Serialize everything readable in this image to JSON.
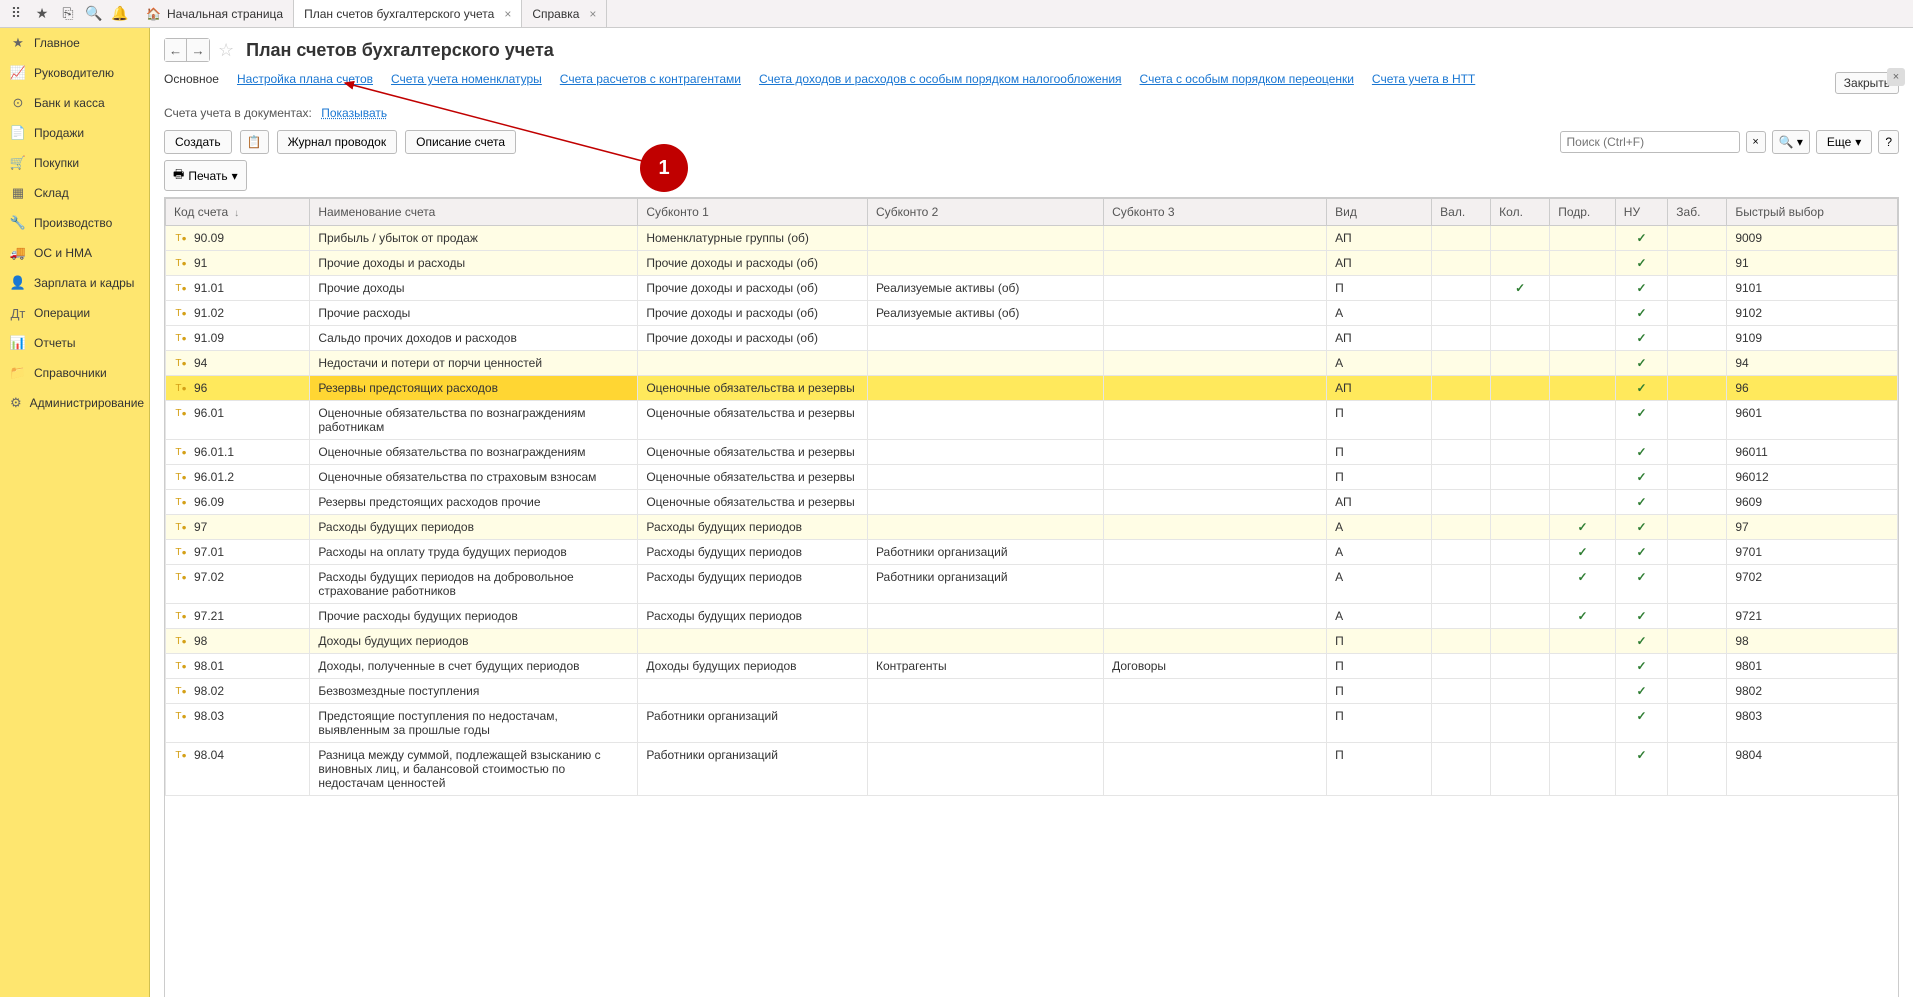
{
  "top_tabs": {
    "home": "Начальная страница",
    "tab1": "План счетов бухгалтерского учета",
    "tab2": "Справка"
  },
  "sidebar": {
    "items": [
      {
        "icon": "★",
        "label": "Главное"
      },
      {
        "icon": "📈",
        "label": "Руководителю"
      },
      {
        "icon": "⊙",
        "label": "Банк и касса"
      },
      {
        "icon": "📄",
        "label": "Продажи"
      },
      {
        "icon": "🛒",
        "label": "Покупки"
      },
      {
        "icon": "▦",
        "label": "Склад"
      },
      {
        "icon": "🔧",
        "label": "Производство"
      },
      {
        "icon": "🚚",
        "label": "ОС и НМА"
      },
      {
        "icon": "👤",
        "label": "Зарплата и кадры"
      },
      {
        "icon": "Дт",
        "label": "Операции"
      },
      {
        "icon": "📊",
        "label": "Отчеты"
      },
      {
        "icon": "📁",
        "label": "Справочники"
      },
      {
        "icon": "⚙",
        "label": "Администрирование"
      }
    ]
  },
  "page": {
    "title": "План счетов бухгалтерского учета",
    "close_btn": "Закрыть"
  },
  "subnav": [
    "Основное",
    "Настройка плана счетов",
    "Счета учета номенклатуры",
    "Счета расчетов с контрагентами",
    "Счета доходов и расходов с особым порядком налогообложения",
    "Счета с особым порядком переоценки",
    "Счета учета в НТТ"
  ],
  "filter": {
    "label": "Счета учета в документах:",
    "link": "Показывать"
  },
  "toolbar": {
    "create": "Создать",
    "journal": "Журнал проводок",
    "description": "Описание счета",
    "print": "Печать",
    "search_placeholder": "Поиск (Ctrl+F)",
    "more": "Еще"
  },
  "columns": {
    "code": "Код счета",
    "name": "Наименование счета",
    "sub1": "Субконто 1",
    "sub2": "Субконто 2",
    "sub3": "Субконто 3",
    "vid": "Вид",
    "val": "Вал.",
    "kol": "Кол.",
    "podr": "Подр.",
    "nu": "НУ",
    "zab": "Заб.",
    "quick": "Быстрый выбор"
  },
  "rows": [
    {
      "yellow": true,
      "icon": "y",
      "code": "90.09",
      "name": "Прибыль / убыток от продаж",
      "sub1": "Номенклатурные группы (об)",
      "sub2": "",
      "sub3": "",
      "vid": "АП",
      "val": "",
      "kol": "",
      "podr": "",
      "nu": "✓",
      "zab": "",
      "quick": "9009"
    },
    {
      "yellow": true,
      "icon": "y",
      "code": "91",
      "name": "Прочие доходы и расходы",
      "sub1": "Прочие доходы и расходы (об)",
      "sub2": "",
      "sub3": "",
      "vid": "АП",
      "val": "",
      "kol": "",
      "podr": "",
      "nu": "✓",
      "zab": "",
      "quick": "91"
    },
    {
      "yellow": false,
      "icon": "y",
      "code": "91.01",
      "name": "Прочие доходы",
      "sub1": "Прочие доходы и расходы (об)",
      "sub2": "Реализуемые активы (об)",
      "sub3": "",
      "vid": "П",
      "val": "",
      "kol": "✓",
      "podr": "",
      "nu": "✓",
      "zab": "",
      "quick": "9101"
    },
    {
      "yellow": false,
      "icon": "y",
      "code": "91.02",
      "name": "Прочие расходы",
      "sub1": "Прочие доходы и расходы (об)",
      "sub2": "Реализуемые активы (об)",
      "sub3": "",
      "vid": "А",
      "val": "",
      "kol": "",
      "podr": "",
      "nu": "✓",
      "zab": "",
      "quick": "9102"
    },
    {
      "yellow": false,
      "icon": "y",
      "code": "91.09",
      "name": "Сальдо прочих доходов и расходов",
      "sub1": "Прочие доходы и расходы (об)",
      "sub2": "",
      "sub3": "",
      "vid": "АП",
      "val": "",
      "kol": "",
      "podr": "",
      "nu": "✓",
      "zab": "",
      "quick": "9109"
    },
    {
      "yellow": true,
      "icon": "y",
      "code": "94",
      "name": "Недостачи и потери от порчи ценностей",
      "sub1": "",
      "sub2": "",
      "sub3": "",
      "vid": "А",
      "val": "",
      "kol": "",
      "podr": "",
      "nu": "✓",
      "zab": "",
      "quick": "94"
    },
    {
      "yellow": true,
      "selected": true,
      "icon": "y",
      "code": "96",
      "name": "Резервы предстоящих расходов",
      "sub1": "Оценочные обязательства и резервы",
      "sub2": "",
      "sub3": "",
      "vid": "АП",
      "val": "",
      "kol": "",
      "podr": "",
      "nu": "✓",
      "zab": "",
      "quick": "96"
    },
    {
      "yellow": false,
      "icon": "y",
      "code": "96.01",
      "name": "Оценочные обязательства по вознаграждениям работникам",
      "sub1": "Оценочные обязательства и резервы",
      "sub2": "",
      "sub3": "",
      "vid": "П",
      "val": "",
      "kol": "",
      "podr": "",
      "nu": "✓",
      "zab": "",
      "quick": "9601"
    },
    {
      "yellow": false,
      "icon": "y",
      "code": "96.01.1",
      "name": "Оценочные обязательства по вознаграждениям",
      "sub1": "Оценочные обязательства и резервы",
      "sub2": "",
      "sub3": "",
      "vid": "П",
      "val": "",
      "kol": "",
      "podr": "",
      "nu": "✓",
      "zab": "",
      "quick": "96011"
    },
    {
      "yellow": false,
      "icon": "y",
      "code": "96.01.2",
      "name": "Оценочные обязательства по страховым взносам",
      "sub1": "Оценочные обязательства и резервы",
      "sub2": "",
      "sub3": "",
      "vid": "П",
      "val": "",
      "kol": "",
      "podr": "",
      "nu": "✓",
      "zab": "",
      "quick": "96012"
    },
    {
      "yellow": false,
      "icon": "y",
      "code": "96.09",
      "name": "Резервы предстоящих расходов прочие",
      "sub1": "Оценочные обязательства и резервы",
      "sub2": "",
      "sub3": "",
      "vid": "АП",
      "val": "",
      "kol": "",
      "podr": "",
      "nu": "✓",
      "zab": "",
      "quick": "9609"
    },
    {
      "yellow": true,
      "icon": "y",
      "code": "97",
      "name": "Расходы будущих периодов",
      "sub1": "Расходы будущих периодов",
      "sub2": "",
      "sub3": "",
      "vid": "А",
      "val": "",
      "kol": "",
      "podr": "✓",
      "nu": "✓",
      "zab": "",
      "quick": "97"
    },
    {
      "yellow": false,
      "icon": "y",
      "code": "97.01",
      "name": "Расходы на оплату труда будущих периодов",
      "sub1": "Расходы будущих периодов",
      "sub2": "Работники организаций",
      "sub3": "",
      "vid": "А",
      "val": "",
      "kol": "",
      "podr": "✓",
      "nu": "✓",
      "zab": "",
      "quick": "9701"
    },
    {
      "yellow": false,
      "icon": "y",
      "code": "97.02",
      "name": "Расходы будущих периодов на добровольное страхование работников",
      "sub1": "Расходы будущих периодов",
      "sub2": "Работники организаций",
      "sub3": "",
      "vid": "А",
      "val": "",
      "kol": "",
      "podr": "✓",
      "nu": "✓",
      "zab": "",
      "quick": "9702"
    },
    {
      "yellow": false,
      "icon": "y",
      "code": "97.21",
      "name": "Прочие расходы будущих периодов",
      "sub1": "Расходы будущих периодов",
      "sub2": "",
      "sub3": "",
      "vid": "А",
      "val": "",
      "kol": "",
      "podr": "✓",
      "nu": "✓",
      "zab": "",
      "quick": "9721"
    },
    {
      "yellow": true,
      "icon": "y",
      "code": "98",
      "name": "Доходы будущих периодов",
      "sub1": "",
      "sub2": "",
      "sub3": "",
      "vid": "П",
      "val": "",
      "kol": "",
      "podr": "",
      "nu": "✓",
      "zab": "",
      "quick": "98"
    },
    {
      "yellow": false,
      "icon": "y",
      "code": "98.01",
      "name": "Доходы, полученные в счет будущих периодов",
      "sub1": "Доходы будущих периодов",
      "sub2": "Контрагенты",
      "sub3": "Договоры",
      "vid": "П",
      "val": "",
      "kol": "",
      "podr": "",
      "nu": "✓",
      "zab": "",
      "quick": "9801"
    },
    {
      "yellow": false,
      "icon": "y",
      "code": "98.02",
      "name": "Безвозмездные поступления",
      "sub1": "",
      "sub2": "",
      "sub3": "",
      "vid": "П",
      "val": "",
      "kol": "",
      "podr": "",
      "nu": "✓",
      "zab": "",
      "quick": "9802"
    },
    {
      "yellow": false,
      "icon": "y",
      "code": "98.03",
      "name": "Предстоящие поступления по недостачам, выявленным за прошлые годы",
      "sub1": "Работники организаций",
      "sub2": "",
      "sub3": "",
      "vid": "П",
      "val": "",
      "kol": "",
      "podr": "",
      "nu": "✓",
      "zab": "",
      "quick": "9803"
    },
    {
      "yellow": false,
      "icon": "y",
      "code": "98.04",
      "name": "Разница между суммой, подлежащей взысканию с виновных лиц, и балансовой стоимостью по недостачам ценностей",
      "sub1": "Работники организаций",
      "sub2": "",
      "sub3": "",
      "vid": "П",
      "val": "",
      "kol": "",
      "podr": "",
      "nu": "✓",
      "zab": "",
      "quick": "9804"
    }
  ],
  "annotation": {
    "number": "1"
  }
}
